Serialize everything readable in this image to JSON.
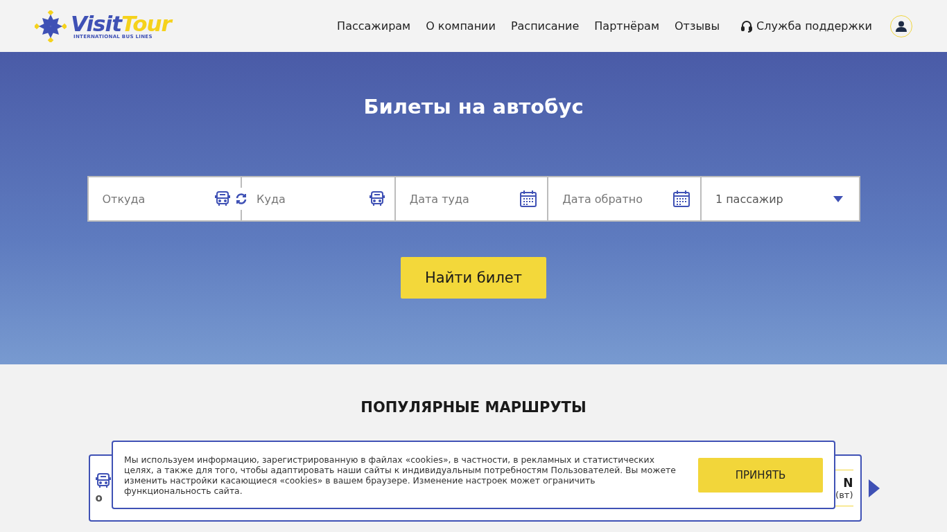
{
  "header": {
    "logo": {
      "part_1": "Visit",
      "part_2": "Tour",
      "tagline": "INTERNATIONAL BUS LINES"
    },
    "nav": [
      {
        "label": "Пассажирам"
      },
      {
        "label": "О компании"
      },
      {
        "label": "Расписание"
      },
      {
        "label": "Партнёрам"
      },
      {
        "label": "Отзывы"
      }
    ],
    "support": {
      "label": "Служба поддержки"
    }
  },
  "hero": {
    "title": "Билеты на автобус",
    "fields": [
      {
        "kind": "place",
        "placeholder": "Откуда"
      },
      {
        "kind": "place",
        "placeholder": "Куда"
      },
      {
        "kind": "date",
        "placeholder": "Дата туда"
      },
      {
        "kind": "date",
        "placeholder": "Дата обратно"
      },
      {
        "kind": "select",
        "value": "1 пассажир"
      }
    ],
    "search_button": "Найти билет"
  },
  "popular": {
    "title": "ПОПУЛЯРНЫЕ МАРШРУТЫ",
    "route_card": {
      "left_text": "о",
      "right_title": "N",
      "right_note": "(вт)"
    }
  },
  "cookie_banner": {
    "text": "Мы используем информацию, зарегистрированную в файлах «cookies», в частности, в рекламных и статистических целях, а также для того, чтобы адаптировать наши сайты к индивидуальным потребностям Пользователей. Вы можете изменить настройки касающиеся «cookies» в вашем браузере. Изменение настроек может ограничить функциональность сайта.",
    "button": "ПРИНЯТЬ"
  }
}
